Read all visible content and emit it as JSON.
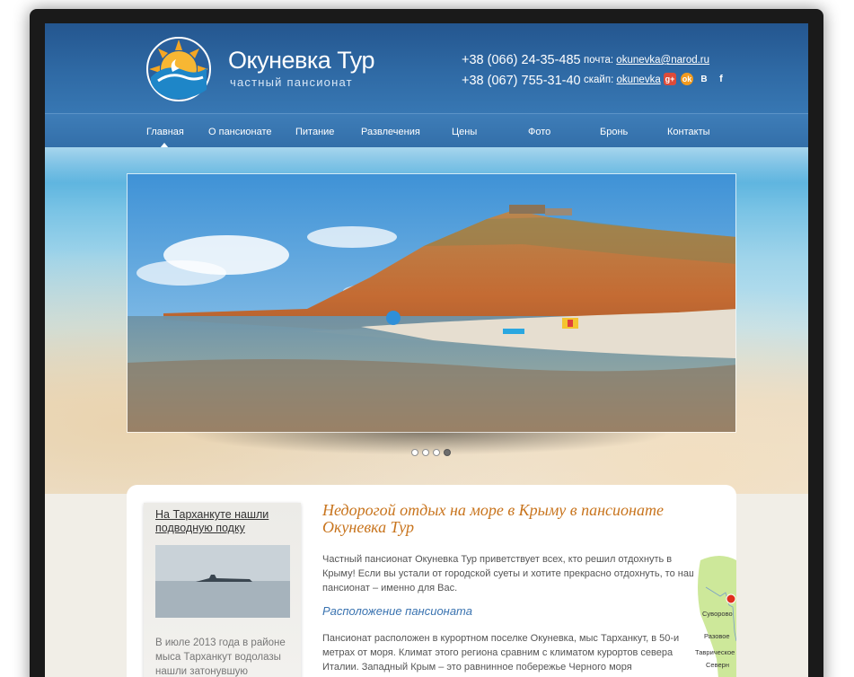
{
  "header": {
    "brand": "Окуневка Тур",
    "tagline": "частный пансионат",
    "phones": [
      "+38 (066) 24-35-485",
      "+38 (067) 755-31-40"
    ],
    "email_label": "почта:",
    "email": "okunevka@narod.ru",
    "skype_label": "скайп:",
    "skype": "okunevka",
    "socials": [
      {
        "name": "google-plus",
        "glyph": "g+"
      },
      {
        "name": "odnoklassniki",
        "glyph": "ok"
      },
      {
        "name": "vkontakte",
        "glyph": "B"
      },
      {
        "name": "facebook",
        "glyph": "f"
      }
    ]
  },
  "nav": {
    "items": [
      "Главная",
      "О пансионате",
      "Питание",
      "Развлечения",
      "Цены",
      "Фото",
      "Бронь",
      "Контакты"
    ],
    "active": "Главная"
  },
  "slider": {
    "dot_count": 4,
    "active_dot": 4
  },
  "sidebar": {
    "news_title": "На Тарханкуте нашли подводную подку",
    "news_text": "В июле 2013 года в районе мыса Тарханкут водолазы нашли затонувшую подводную"
  },
  "main": {
    "title": "Недорогой отдых на море в Крыму в пансионате Окуневка Тур",
    "intro": "Частный пансионат Окуневка Тур приветствует всех, кто решил отдохнуть в Крыму! Если вы устали от городской суеты и хотите прекрасно отдохнуть, то наш пансионат – именно для Вас.",
    "subheading": "Расположение пансионата",
    "location_text": "Пансионат расположен в курортном поселке Окуневка, мыс Тарханкут, в 50-и метрах от моря. Климат этого региона сравним с климатом курортов севера Италии. Западный Крым – это равнинное побережье Черного моря",
    "map_labels": [
      "Суворово",
      "Разовое",
      "Таврическое",
      "Северн"
    ]
  },
  "colors": {
    "header_blue": "#2f6aa5",
    "title_orange": "#c8741d",
    "subheading_blue": "#3a73b0"
  }
}
